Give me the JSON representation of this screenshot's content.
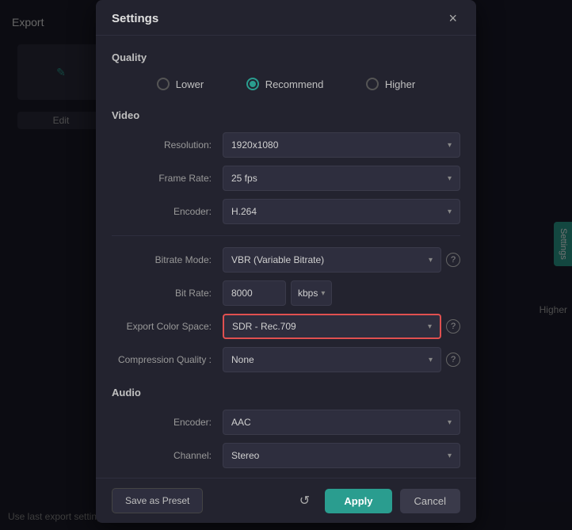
{
  "app": {
    "title": "Export"
  },
  "modal": {
    "title": "Settings",
    "close_label": "×"
  },
  "quality": {
    "section_label": "Quality",
    "options": [
      {
        "id": "lower",
        "label": "Lower",
        "checked": false
      },
      {
        "id": "recommend",
        "label": "Recommend",
        "checked": true
      },
      {
        "id": "higher",
        "label": "Higher",
        "checked": false
      }
    ]
  },
  "video": {
    "section_label": "Video",
    "fields": {
      "resolution": {
        "label": "Resolution:",
        "value": "1920x1080"
      },
      "frame_rate": {
        "label": "Frame Rate:",
        "value": "25 fps"
      },
      "encoder": {
        "label": "Encoder:",
        "value": "H.264"
      },
      "bitrate_mode": {
        "label": "Bitrate Mode:",
        "value": "VBR (Variable Bitrate)"
      },
      "bit_rate_value": "8000",
      "bit_rate_unit": "kbps",
      "bit_rate_label": "Bit Rate:",
      "export_color_space": {
        "label": "Export Color Space:",
        "value": "SDR - Rec.709"
      },
      "compression_quality": {
        "label": "Compression Quality :",
        "value": "None"
      }
    }
  },
  "audio": {
    "section_label": "Audio",
    "fields": {
      "encoder": {
        "label": "Encoder:",
        "value": "AAC"
      },
      "channel": {
        "label": "Channel:",
        "value": "Stereo"
      }
    }
  },
  "footer": {
    "save_preset_label": "Save as Preset",
    "reset_icon": "↺",
    "apply_label": "Apply",
    "cancel_label": "Cancel"
  },
  "sidebar": {
    "title": "Export",
    "edit_label": "Edit",
    "settings_label": "Settings"
  },
  "bottom_bar": {
    "text": "Use last export setting"
  },
  "icons": {
    "ai": "✎",
    "help": "?",
    "higher": "Higher",
    "chevron": "▾"
  }
}
